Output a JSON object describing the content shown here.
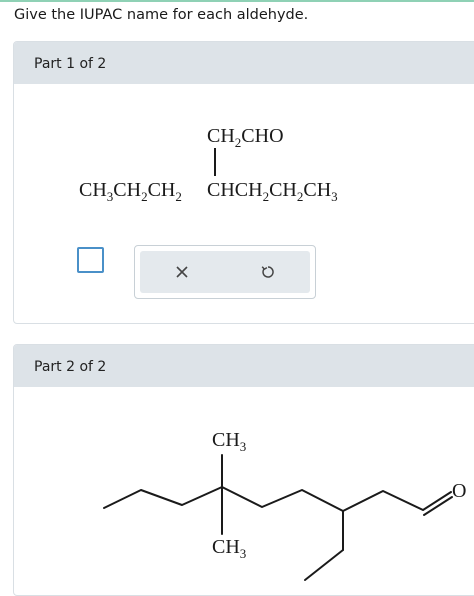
{
  "question": "Give the IUPAC name for each aldehyde.",
  "part1": {
    "header": "Part 1 of 2",
    "structure": {
      "branch": [
        "CH",
        "2",
        "CHO"
      ],
      "main_left": [
        "CH",
        "3",
        "CH",
        "2",
        "CH",
        "2"
      ],
      "main_right": [
        "CHCH",
        "2",
        "CH",
        "2",
        "CH",
        "3"
      ]
    }
  },
  "part2": {
    "header": "Part 2 of 2",
    "structure": {
      "top_methyl": [
        "CH",
        "3"
      ],
      "bottom_methyl": [
        "CH",
        "3"
      ],
      "oxygen": "O"
    }
  },
  "tools": {
    "clear_icon": "x-icon",
    "undo_icon": "undo-icon"
  },
  "colors": {
    "header_bg": "#dde3e8",
    "checkbox_border": "#4a90c8",
    "toolbar_bg": "#e4e9ed",
    "top_accent": "#8fd1b5"
  }
}
